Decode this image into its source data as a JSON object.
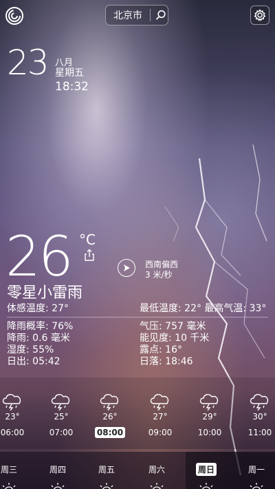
{
  "header": {
    "city": "北京市"
  },
  "date": {
    "day": "23",
    "month": "八月",
    "weekday": "星期五",
    "time": "18:32"
  },
  "current": {
    "temperature": "26",
    "unit": "°C",
    "condition": "零星小雷雨",
    "feels_like": "体感温度: 27°",
    "min_max": "最低温度: 22°  最高气温: 33°",
    "wind_direction": "西南偏西",
    "wind_speed": "3 米/秒"
  },
  "details": {
    "left": [
      "降雨概率: 76%",
      "降雨: 0.6 毫米",
      "湿度: 55%",
      "日出: 05:42"
    ],
    "right": [
      "气压: 757 毫米",
      "能见度: 10 千米",
      "露点: 16°",
      "日落: 18:46"
    ]
  },
  "hourly": [
    {
      "temp": "23°",
      "time": "06:00",
      "active": false
    },
    {
      "temp": "25°",
      "time": "07:00",
      "active": false
    },
    {
      "temp": "26°",
      "time": "08:00",
      "active": true
    },
    {
      "temp": "27°",
      "time": "09:00",
      "active": false
    },
    {
      "temp": "29°",
      "time": "10:00",
      "active": false
    },
    {
      "temp": "30°",
      "time": "11:00",
      "active": false
    }
  ],
  "daily": [
    {
      "label": "周三",
      "active": false
    },
    {
      "label": "周四",
      "active": false
    },
    {
      "label": "周五",
      "active": false
    },
    {
      "label": "周六",
      "active": false
    },
    {
      "label": "周日",
      "active": true
    },
    {
      "label": "周一",
      "active": false
    }
  ],
  "icons": {
    "logo": "app-logo-icon",
    "search": "search-icon",
    "settings": "gear-icon",
    "share": "share-icon",
    "wind": "wind-direction-icon",
    "hourly": "thunder-rain-cloud-icon",
    "daily": "partly-sunny-icon"
  }
}
